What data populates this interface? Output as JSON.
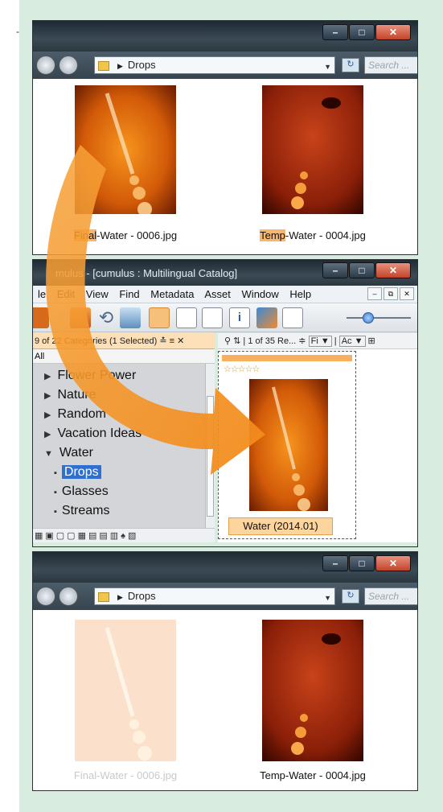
{
  "top_explorer": {
    "path": "Drops",
    "search_placeholder": "Search ...",
    "files": [
      {
        "name_highlight": "Final",
        "name_rest": "-Water - 0006.jpg"
      },
      {
        "name_highlight": "Temp",
        "name_rest": "-Water - 0004.jpg"
      }
    ]
  },
  "cumulus": {
    "title": "Cumulus - [cumulus : Multilingual Catalog]",
    "title_visible": "mulus - [cumulus : Multilingual Catalog]",
    "menu": [
      "File",
      "Edit",
      "View",
      "Find",
      "Metadata",
      "Asset",
      "Window",
      "Help"
    ],
    "menu_visible_file": "le",
    "categories_header": "9 of 22 Categories (1 Selected)",
    "tab_all": "All",
    "tree": [
      {
        "label": "Flower Power",
        "expanded": false,
        "level": 0
      },
      {
        "label": "Nature",
        "expanded": false,
        "level": 0
      },
      {
        "label": "Random",
        "expanded": false,
        "level": 0
      },
      {
        "label": "Vacation Ideas",
        "expanded": false,
        "level": 0
      },
      {
        "label": "Water",
        "expanded": true,
        "level": 0
      },
      {
        "label": "Drops",
        "level": 1,
        "selected": true
      },
      {
        "label": "Glasses",
        "level": 1
      },
      {
        "label": "Streams",
        "level": 1
      }
    ],
    "records_header": "1 of 35 Re...",
    "sort_field": "Fi",
    "sort_field2": "Ac",
    "rating_stars": "☆☆☆☆☆",
    "asset_caption": "Water (2014.01)"
  },
  "bottom_explorer": {
    "path": "Drops",
    "search_placeholder": "Search ...",
    "files": [
      {
        "name": "Final-Water - 0006.jpg",
        "faded": true
      },
      {
        "name": "Temp-Water - 0004.jpg",
        "faded": false
      }
    ]
  },
  "colors": {
    "accent_orange": "#f7a23a",
    "highlight": "#f9b66c",
    "selection_blue": "#2f6fd0"
  }
}
